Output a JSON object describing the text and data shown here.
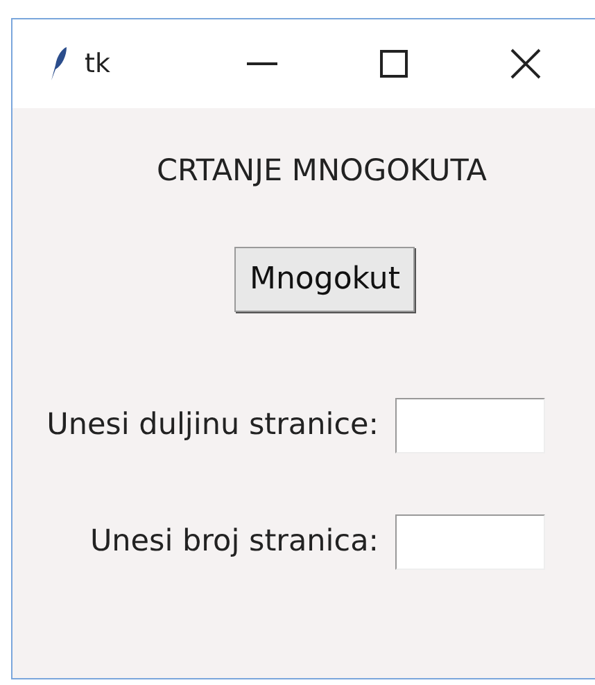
{
  "window": {
    "title": "tk"
  },
  "heading": "CRTANJE MNOGOKUTA",
  "button": "Mnogokut",
  "fields": [
    {
      "label": "Unesi duljinu stranice:"
    },
    {
      "label": "Unesi broj stranica:"
    }
  ]
}
